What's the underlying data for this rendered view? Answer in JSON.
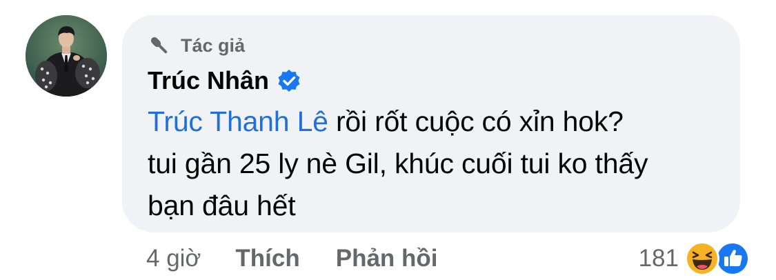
{
  "comment": {
    "badge_label": "Tác giả",
    "author_name": "Trúc Nhân",
    "mention": "Trúc Thanh Lê",
    "text_line1": " rồi rốt cuộc có xỉn hok?",
    "text_line2": "tui gần 25 ly nè Gil, khúc cuối tui ko thấy",
    "text_line3": "bạn đâu hết"
  },
  "actions": {
    "time": "4 giờ",
    "like_label": "Thích",
    "reply_label": "Phản hồi"
  },
  "reactions": {
    "count": "181",
    "icons": [
      "haha-icon",
      "like-icon"
    ]
  },
  "colors": {
    "bubble": "#f0f2f5",
    "mention": "#216fdb",
    "secondary_text": "#65676b",
    "verified": "#1877f2",
    "haha": "#f7b125",
    "like": "#1877f2"
  }
}
